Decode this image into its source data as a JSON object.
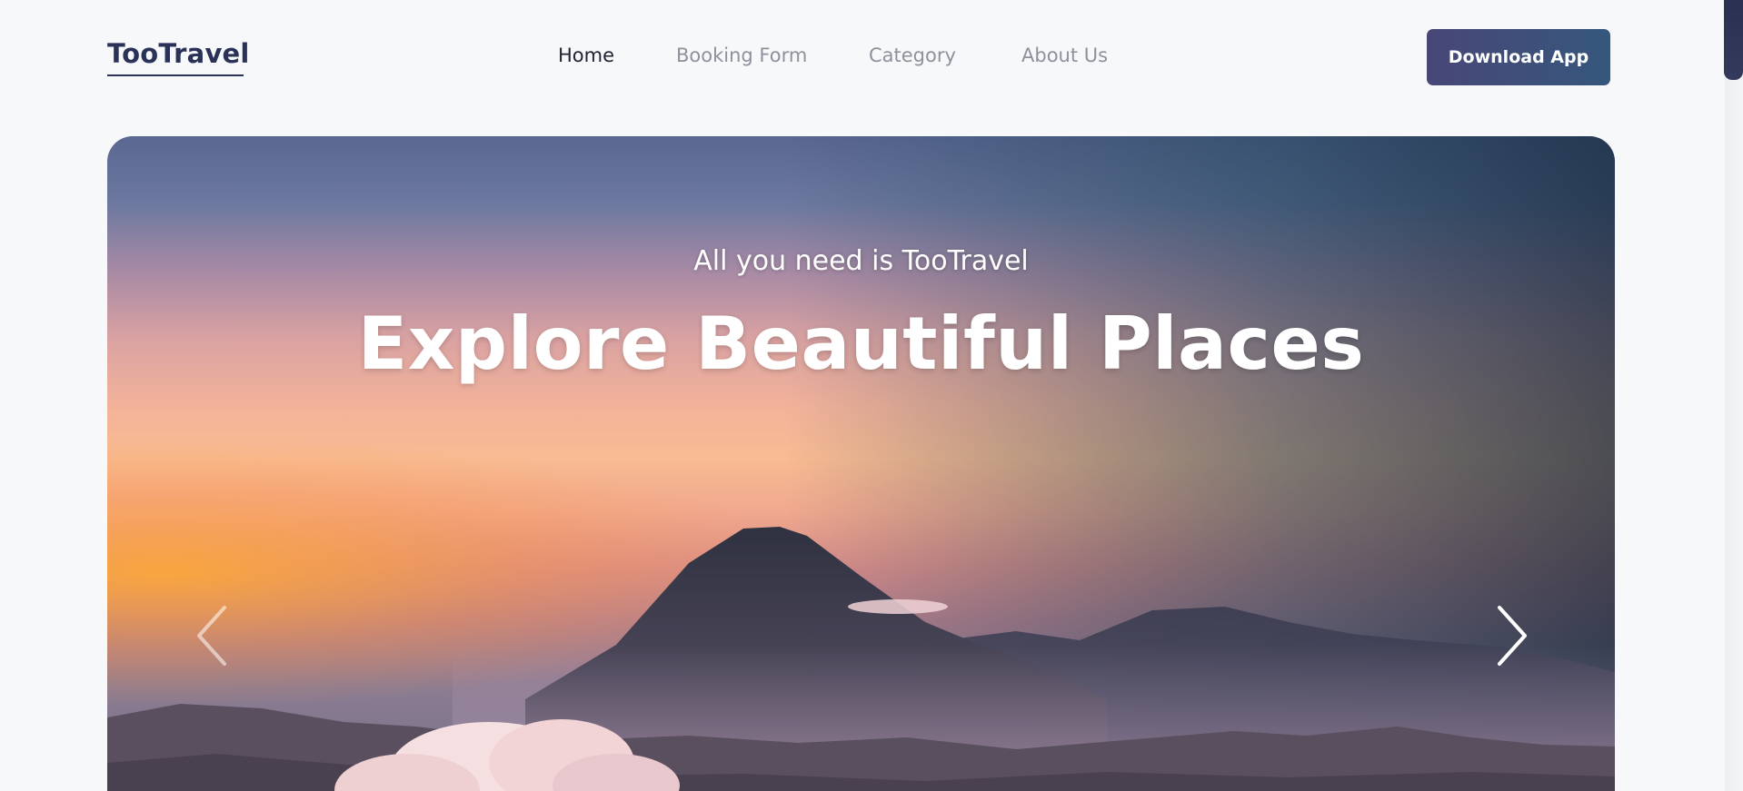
{
  "header": {
    "logo": "TooTravel",
    "nav": [
      {
        "label": "Home",
        "active": true
      },
      {
        "label": "Booking Form",
        "active": false
      },
      {
        "label": "Category",
        "active": false
      },
      {
        "label": "About Us",
        "active": false
      }
    ],
    "cta_label": "Download App"
  },
  "hero": {
    "subtitle": "All you need is TooTravel",
    "title": "Explore Beautiful Places",
    "prev_icon": "chevron-left-icon",
    "next_icon": "chevron-right-icon"
  },
  "colors": {
    "brand": "#2b3258",
    "nav_inactive": "#8d919b",
    "cta_start": "#484777",
    "cta_end": "#36577c"
  }
}
